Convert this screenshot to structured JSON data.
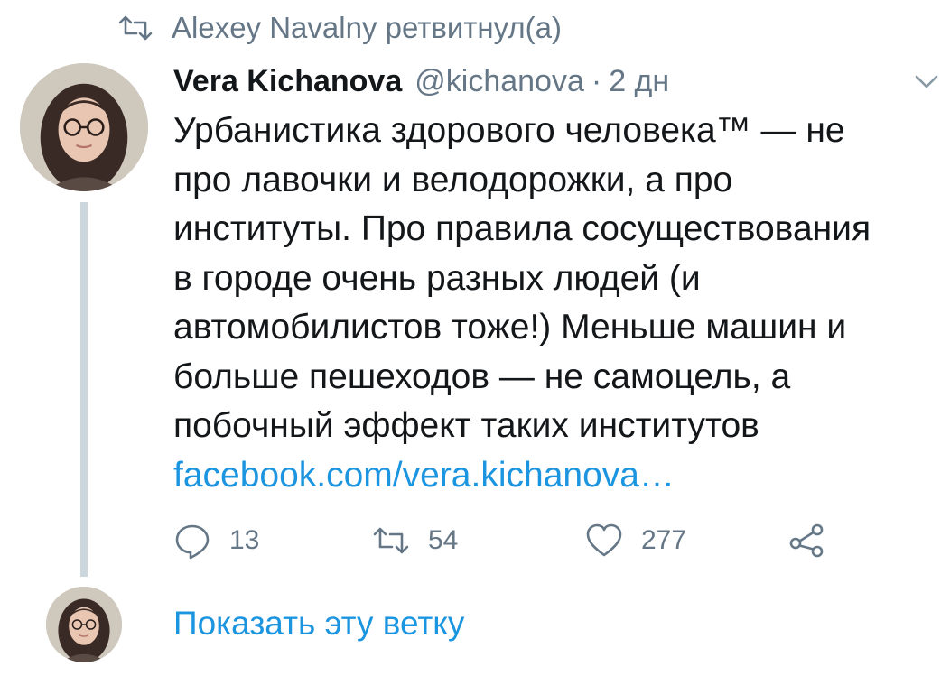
{
  "retweet_context": {
    "text": "Alexey Navalny ретвитнул(а)",
    "icon": "retweet-icon"
  },
  "tweet": {
    "author_name": "Vera Kichanova",
    "handle": "@kichanova",
    "separator": "·",
    "time": "2 дн",
    "text_lines": [
      "Урбанистика здорового человека™ — не",
      "про лавочки и велодорожки, а про",
      "институты. Про правила сосуществования",
      "в городе очень разных людей (и",
      "автомобилистов тоже!) Меньше машин и",
      "больше пешеходов — не самоцель, а",
      "побочный эффект таких институтов"
    ],
    "link": "facebook.com/vera.kichanova…",
    "caret_icon": "chevron-down-icon",
    "actions": {
      "reply": {
        "icon": "reply-icon",
        "count": "13"
      },
      "retweet": {
        "icon": "retweet-icon",
        "count": "54"
      },
      "like": {
        "icon": "heart-icon",
        "count": "277"
      },
      "share": {
        "icon": "share-icon",
        "count": ""
      }
    }
  },
  "show_thread": {
    "label": "Показать эту ветку"
  },
  "colors": {
    "text": "#14171a",
    "secondary": "#657786",
    "link": "#1b95e0",
    "thread_line": "#ccd6dd",
    "background": "#ffffff"
  }
}
